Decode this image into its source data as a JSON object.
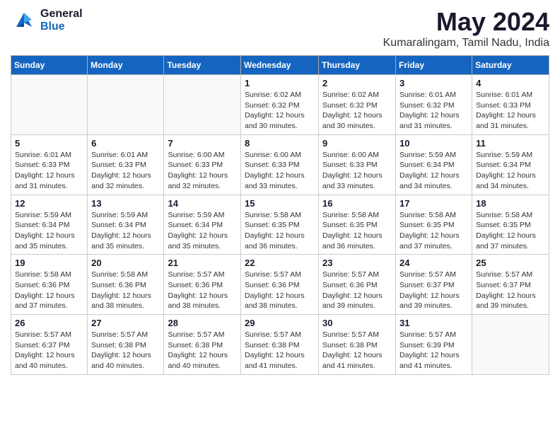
{
  "header": {
    "logo_general": "General",
    "logo_blue": "Blue",
    "title": "May 2024",
    "location": "Kumaralingam, Tamil Nadu, India"
  },
  "weekdays": [
    "Sunday",
    "Monday",
    "Tuesday",
    "Wednesday",
    "Thursday",
    "Friday",
    "Saturday"
  ],
  "weeks": [
    {
      "days": [
        {
          "num": "",
          "info": ""
        },
        {
          "num": "",
          "info": ""
        },
        {
          "num": "",
          "info": ""
        },
        {
          "num": "1",
          "info": "Sunrise: 6:02 AM\nSunset: 6:32 PM\nDaylight: 12 hours\nand 30 minutes."
        },
        {
          "num": "2",
          "info": "Sunrise: 6:02 AM\nSunset: 6:32 PM\nDaylight: 12 hours\nand 30 minutes."
        },
        {
          "num": "3",
          "info": "Sunrise: 6:01 AM\nSunset: 6:32 PM\nDaylight: 12 hours\nand 31 minutes."
        },
        {
          "num": "4",
          "info": "Sunrise: 6:01 AM\nSunset: 6:33 PM\nDaylight: 12 hours\nand 31 minutes."
        }
      ]
    },
    {
      "days": [
        {
          "num": "5",
          "info": "Sunrise: 6:01 AM\nSunset: 6:33 PM\nDaylight: 12 hours\nand 31 minutes."
        },
        {
          "num": "6",
          "info": "Sunrise: 6:01 AM\nSunset: 6:33 PM\nDaylight: 12 hours\nand 32 minutes."
        },
        {
          "num": "7",
          "info": "Sunrise: 6:00 AM\nSunset: 6:33 PM\nDaylight: 12 hours\nand 32 minutes."
        },
        {
          "num": "8",
          "info": "Sunrise: 6:00 AM\nSunset: 6:33 PM\nDaylight: 12 hours\nand 33 minutes."
        },
        {
          "num": "9",
          "info": "Sunrise: 6:00 AM\nSunset: 6:33 PM\nDaylight: 12 hours\nand 33 minutes."
        },
        {
          "num": "10",
          "info": "Sunrise: 5:59 AM\nSunset: 6:34 PM\nDaylight: 12 hours\nand 34 minutes."
        },
        {
          "num": "11",
          "info": "Sunrise: 5:59 AM\nSunset: 6:34 PM\nDaylight: 12 hours\nand 34 minutes."
        }
      ]
    },
    {
      "days": [
        {
          "num": "12",
          "info": "Sunrise: 5:59 AM\nSunset: 6:34 PM\nDaylight: 12 hours\nand 35 minutes."
        },
        {
          "num": "13",
          "info": "Sunrise: 5:59 AM\nSunset: 6:34 PM\nDaylight: 12 hours\nand 35 minutes."
        },
        {
          "num": "14",
          "info": "Sunrise: 5:59 AM\nSunset: 6:34 PM\nDaylight: 12 hours\nand 35 minutes."
        },
        {
          "num": "15",
          "info": "Sunrise: 5:58 AM\nSunset: 6:35 PM\nDaylight: 12 hours\nand 36 minutes."
        },
        {
          "num": "16",
          "info": "Sunrise: 5:58 AM\nSunset: 6:35 PM\nDaylight: 12 hours\nand 36 minutes."
        },
        {
          "num": "17",
          "info": "Sunrise: 5:58 AM\nSunset: 6:35 PM\nDaylight: 12 hours\nand 37 minutes."
        },
        {
          "num": "18",
          "info": "Sunrise: 5:58 AM\nSunset: 6:35 PM\nDaylight: 12 hours\nand 37 minutes."
        }
      ]
    },
    {
      "days": [
        {
          "num": "19",
          "info": "Sunrise: 5:58 AM\nSunset: 6:36 PM\nDaylight: 12 hours\nand 37 minutes."
        },
        {
          "num": "20",
          "info": "Sunrise: 5:58 AM\nSunset: 6:36 PM\nDaylight: 12 hours\nand 38 minutes."
        },
        {
          "num": "21",
          "info": "Sunrise: 5:57 AM\nSunset: 6:36 PM\nDaylight: 12 hours\nand 38 minutes."
        },
        {
          "num": "22",
          "info": "Sunrise: 5:57 AM\nSunset: 6:36 PM\nDaylight: 12 hours\nand 38 minutes."
        },
        {
          "num": "23",
          "info": "Sunrise: 5:57 AM\nSunset: 6:36 PM\nDaylight: 12 hours\nand 39 minutes."
        },
        {
          "num": "24",
          "info": "Sunrise: 5:57 AM\nSunset: 6:37 PM\nDaylight: 12 hours\nand 39 minutes."
        },
        {
          "num": "25",
          "info": "Sunrise: 5:57 AM\nSunset: 6:37 PM\nDaylight: 12 hours\nand 39 minutes."
        }
      ]
    },
    {
      "days": [
        {
          "num": "26",
          "info": "Sunrise: 5:57 AM\nSunset: 6:37 PM\nDaylight: 12 hours\nand 40 minutes."
        },
        {
          "num": "27",
          "info": "Sunrise: 5:57 AM\nSunset: 6:38 PM\nDaylight: 12 hours\nand 40 minutes."
        },
        {
          "num": "28",
          "info": "Sunrise: 5:57 AM\nSunset: 6:38 PM\nDaylight: 12 hours\nand 40 minutes."
        },
        {
          "num": "29",
          "info": "Sunrise: 5:57 AM\nSunset: 6:38 PM\nDaylight: 12 hours\nand 41 minutes."
        },
        {
          "num": "30",
          "info": "Sunrise: 5:57 AM\nSunset: 6:38 PM\nDaylight: 12 hours\nand 41 minutes."
        },
        {
          "num": "31",
          "info": "Sunrise: 5:57 AM\nSunset: 6:39 PM\nDaylight: 12 hours\nand 41 minutes."
        },
        {
          "num": "",
          "info": ""
        }
      ]
    }
  ]
}
